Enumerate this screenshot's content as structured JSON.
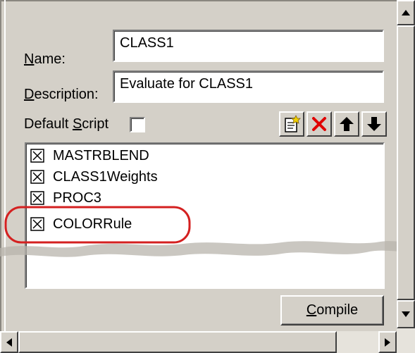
{
  "form": {
    "name_label": "Name:",
    "name_accel": "N",
    "name_rest": "ame:",
    "name_value": "CLASS1",
    "description_label": "Description:",
    "description_accel": "D",
    "description_rest": "escription:",
    "description_value": "Evaluate for CLASS1",
    "default_script_pre": "Default ",
    "default_script_accel": "S",
    "default_script_rest": "cript",
    "default_script_checked": false
  },
  "toolbar": {
    "icons": [
      "new-script-icon",
      "delete-icon",
      "move-up-icon",
      "move-down-icon"
    ],
    "delete_color": "#e00000"
  },
  "scripts": [
    {
      "label": "MASTRBLEND",
      "checked": true
    },
    {
      "label": "CLASS1Weights",
      "checked": true
    },
    {
      "label": "PROC3",
      "checked": true
    },
    {
      "label": "COLORRule",
      "checked": true
    }
  ],
  "highlight": {
    "target": "COLORRule",
    "color": "#d42020"
  },
  "compile_button": {
    "accel": "C",
    "rest": "ompile"
  }
}
